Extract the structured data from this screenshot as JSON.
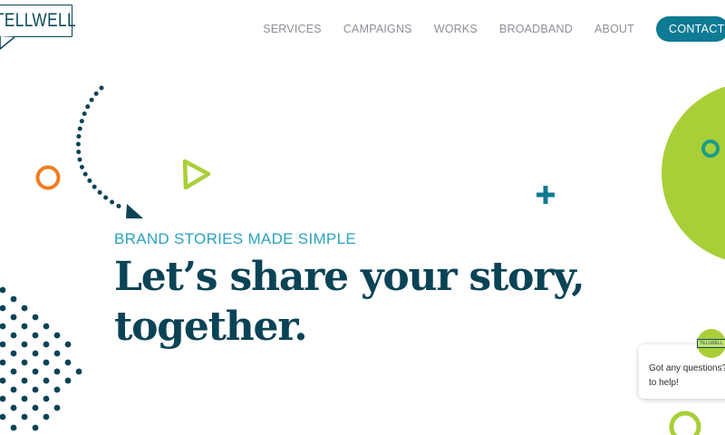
{
  "brand": {
    "logo_text": "TELLWELL"
  },
  "nav": {
    "items": [
      "SERVICES",
      "CAMPAIGNS",
      "WORKS",
      "BROADBAND",
      "ABOUT"
    ],
    "cta": "CONTACT"
  },
  "hero": {
    "subtitle": "BRAND STORIES MADE SIMPLE",
    "title_line1": "Let’s share your story,",
    "title_line2": "together."
  },
  "chat": {
    "message": "Got any questions? W\nto help!",
    "avatar_logo": "TELLWELL"
  },
  "colors": {
    "navy": "#0b4356",
    "teal": "#0e7a94",
    "lime": "#a9cf38",
    "orange": "#f07f1e"
  },
  "icons": [
    "logo-speech-tail-icon",
    "dotted-arrow-icon",
    "orange-ring-icon",
    "lime-triangle-icon",
    "plus-icon",
    "lime-circle-icon",
    "teal-ring-icon",
    "dot-pattern-icon",
    "lime-ring-icon"
  ]
}
